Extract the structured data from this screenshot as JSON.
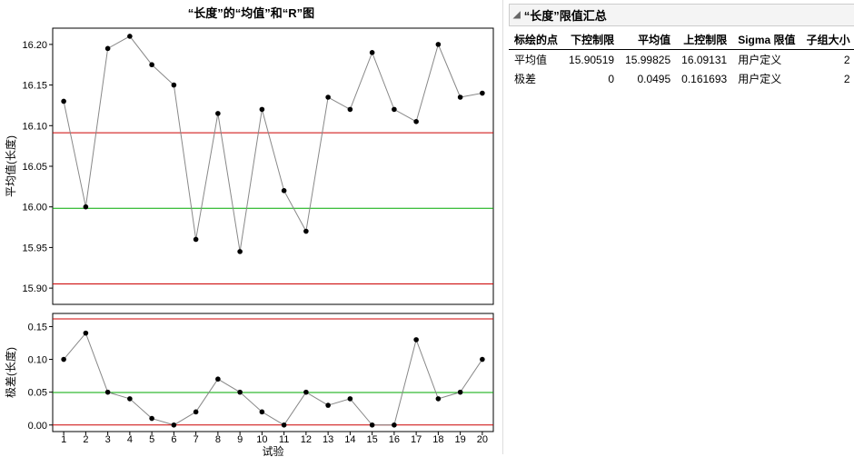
{
  "chart_title": "“长度”的“均值”和“R”图",
  "xlabel": "试验",
  "ylabel_mean": "平均值(长度)",
  "ylabel_range": "极差(长度)",
  "panel_title": "“长度”限值汇总",
  "table_headers": {
    "point": "标绘的点",
    "lcl": "下控制限",
    "mean": "平均值",
    "ucl": "上控制限",
    "sigma": "Sigma 限值",
    "subgroup": "子组大小"
  },
  "table_rows": [
    {
      "point": "平均值",
      "lcl": "15.90519",
      "mean": "15.99825",
      "ucl": "16.09131",
      "sigma": "用户定义",
      "subgroup": "2"
    },
    {
      "point": "极差",
      "lcl": "0",
      "mean": "0.0495",
      "ucl": "0.161693",
      "sigma": "用户定义",
      "subgroup": "2"
    }
  ],
  "chart_data": [
    {
      "type": "line",
      "name": "mean_chart",
      "title": "平均值控制图",
      "ylabel": "平均值(长度)",
      "xlabel": "试验",
      "x": [
        1,
        2,
        3,
        4,
        5,
        6,
        7,
        8,
        9,
        10,
        11,
        12,
        13,
        14,
        15,
        16,
        17,
        18,
        19,
        20
      ],
      "values": [
        16.13,
        16.0,
        16.195,
        16.21,
        16.175,
        16.15,
        15.96,
        16.115,
        15.945,
        16.12,
        16.02,
        15.97,
        16.135,
        16.12,
        16.19,
        16.12,
        16.105,
        16.2,
        16.135,
        16.14
      ],
      "cl": 15.99825,
      "ucl": 16.09131,
      "lcl": 15.90519,
      "ylim": [
        15.88,
        16.22
      ],
      "yticks": [
        15.9,
        15.95,
        16.0,
        16.05,
        16.1,
        16.15,
        16.2
      ]
    },
    {
      "type": "line",
      "name": "range_chart",
      "title": "极差控制图",
      "ylabel": "极差(长度)",
      "xlabel": "试验",
      "x": [
        1,
        2,
        3,
        4,
        5,
        6,
        7,
        8,
        9,
        10,
        11,
        12,
        13,
        14,
        15,
        16,
        17,
        18,
        19,
        20
      ],
      "values": [
        0.1,
        0.14,
        0.05,
        0.04,
        0.01,
        0.0,
        0.02,
        0.07,
        0.05,
        0.02,
        0.0,
        0.05,
        0.03,
        0.04,
        0.0,
        0.0,
        0.13,
        0.04,
        0.05,
        0.1
      ],
      "cl": 0.0495,
      "ucl": 0.161693,
      "lcl": 0,
      "ylim": [
        -0.01,
        0.17
      ],
      "yticks": [
        0,
        0.05,
        0.1,
        0.15
      ]
    }
  ]
}
